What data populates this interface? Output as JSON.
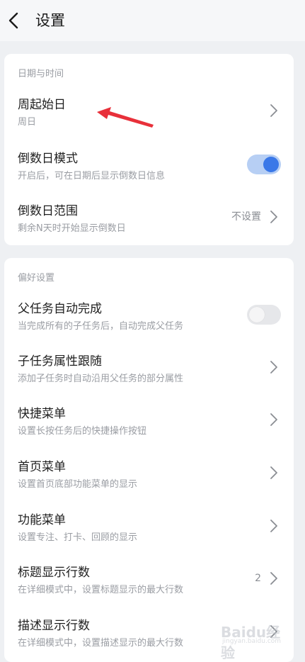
{
  "header": {
    "title": "设置",
    "back_icon": "chevron-left-icon"
  },
  "date_time": {
    "section_title": "日期与时间",
    "week_start": {
      "title": "周起始日",
      "subtitle": "周日"
    },
    "countdown_mode": {
      "title": "倒数日模式",
      "subtitle": "开启后，可在日期后显示倒数日信息",
      "enabled": true
    },
    "countdown_range": {
      "title": "倒数日范围",
      "subtitle": "剩余N天时开始显示倒数日",
      "value": "不设置"
    }
  },
  "preferences": {
    "section_title": "偏好设置",
    "auto_complete_parent": {
      "title": "父任务自动完成",
      "subtitle": "当完成所有的子任务后，自动完成父任务",
      "enabled": false
    },
    "subtask_inherit": {
      "title": "子任务属性跟随",
      "subtitle": "添加子任务时自动沿用父任务的部分属性"
    },
    "quick_menu": {
      "title": "快捷菜单",
      "subtitle": "设置长按任务后的快捷操作按钮"
    },
    "home_menu": {
      "title": "首页菜单",
      "subtitle": "设置首页底部功能菜单的显示"
    },
    "feature_menu": {
      "title": "功能菜单",
      "subtitle": "设置专注、打卡、回顾的显示"
    },
    "title_lines": {
      "title": "标题显示行数",
      "subtitle": "在详细模式中，设置标题显示的最大行数",
      "value": "2"
    },
    "desc_lines": {
      "title": "描述显示行数",
      "subtitle": "在详细模式中，设置描述显示的最大行数"
    }
  },
  "watermark": {
    "main": "Baidu经验",
    "sub": "jingyan.baidu.com"
  },
  "colors": {
    "accent": "#3a78e8",
    "toggle_on_track": "#b7cff4",
    "annotation_arrow": "#e8303a"
  }
}
